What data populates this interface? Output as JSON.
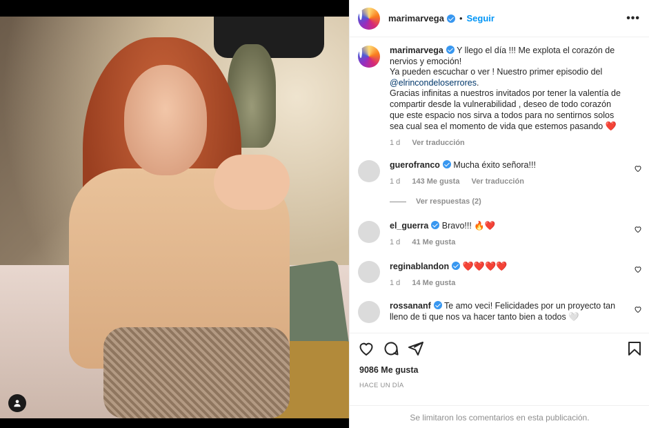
{
  "post": {
    "username": "marimarvega",
    "follow_label": "Seguir",
    "dot": "•",
    "more": "•••"
  },
  "caption": {
    "username": "marimarvega",
    "text_1": "Y llego el día !!! Me explota el corazón de nervios y emoción!",
    "text_2": "Ya pueden escuchar o ver ! Nuestro primer episodio del",
    "mention": "@elrincondeloserrores",
    "text_3": ".",
    "text_4": "Gracias infinitas a nuestros invitados por tener la valentía de compartir desde la vulnerabilidad , deseo de todo corazón que este espacio nos sirva a todos para no sentirnos solos sea cual sea el momento de vida que estemos pasando",
    "emoji": "❤️",
    "time": "1 d",
    "translate": "Ver traducción"
  },
  "comments": [
    {
      "username": "guerofranco",
      "text": "Mucha éxito señora!!!",
      "time": "1 d",
      "likes": "143 Me gusta",
      "translate": "Ver traducción"
    },
    {
      "username": "el_guerra",
      "text": "Bravo!!! 🔥❤️",
      "time": "1 d",
      "likes": "41 Me gusta"
    },
    {
      "username": "reginablandon",
      "text": "❤️❤️❤️❤️",
      "time": "1 d",
      "likes": "14 Me gusta"
    },
    {
      "username": "rossananf",
      "text": "Te amo veci! Felicidades por un proyecto tan lleno de ti que nos va hacer tanto bien a todos 🤍"
    }
  ],
  "replies_label": "Ver respuestas (2)",
  "footer": {
    "likes": "9086 Me gusta",
    "time": "HACE UN DÍA",
    "limited": "Se limitaron los comentarios en esta publicación."
  },
  "colors": {
    "accent": "#0095f6",
    "verified": "#3897f0",
    "heart": "#ed4956"
  },
  "icons": [
    "user-tag-icon",
    "verified-icon",
    "more-icon",
    "heart-icon",
    "comment-icon",
    "share-icon",
    "bookmark-icon"
  ]
}
